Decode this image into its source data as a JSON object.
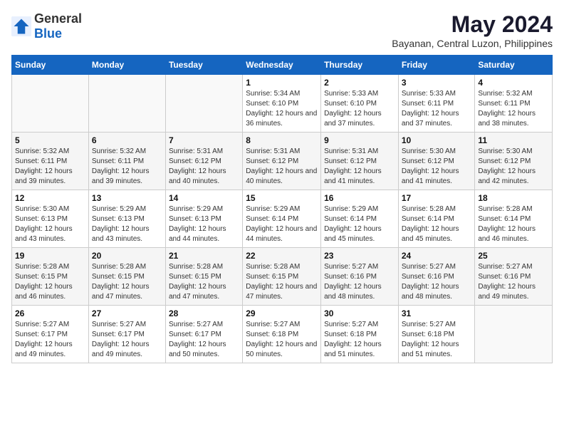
{
  "logo": {
    "general": "General",
    "blue": "Blue"
  },
  "title": "May 2024",
  "subtitle": "Bayanan, Central Luzon, Philippines",
  "weekdays": [
    "Sunday",
    "Monday",
    "Tuesday",
    "Wednesday",
    "Thursday",
    "Friday",
    "Saturday"
  ],
  "weeks": [
    [
      {
        "day": "",
        "info": ""
      },
      {
        "day": "",
        "info": ""
      },
      {
        "day": "",
        "info": ""
      },
      {
        "day": "1",
        "info": "Sunrise: 5:34 AM\nSunset: 6:10 PM\nDaylight: 12 hours and 36 minutes."
      },
      {
        "day": "2",
        "info": "Sunrise: 5:33 AM\nSunset: 6:10 PM\nDaylight: 12 hours and 37 minutes."
      },
      {
        "day": "3",
        "info": "Sunrise: 5:33 AM\nSunset: 6:11 PM\nDaylight: 12 hours and 37 minutes."
      },
      {
        "day": "4",
        "info": "Sunrise: 5:32 AM\nSunset: 6:11 PM\nDaylight: 12 hours and 38 minutes."
      }
    ],
    [
      {
        "day": "5",
        "info": "Sunrise: 5:32 AM\nSunset: 6:11 PM\nDaylight: 12 hours and 39 minutes."
      },
      {
        "day": "6",
        "info": "Sunrise: 5:32 AM\nSunset: 6:11 PM\nDaylight: 12 hours and 39 minutes."
      },
      {
        "day": "7",
        "info": "Sunrise: 5:31 AM\nSunset: 6:12 PM\nDaylight: 12 hours and 40 minutes."
      },
      {
        "day": "8",
        "info": "Sunrise: 5:31 AM\nSunset: 6:12 PM\nDaylight: 12 hours and 40 minutes."
      },
      {
        "day": "9",
        "info": "Sunrise: 5:31 AM\nSunset: 6:12 PM\nDaylight: 12 hours and 41 minutes."
      },
      {
        "day": "10",
        "info": "Sunrise: 5:30 AM\nSunset: 6:12 PM\nDaylight: 12 hours and 41 minutes."
      },
      {
        "day": "11",
        "info": "Sunrise: 5:30 AM\nSunset: 6:12 PM\nDaylight: 12 hours and 42 minutes."
      }
    ],
    [
      {
        "day": "12",
        "info": "Sunrise: 5:30 AM\nSunset: 6:13 PM\nDaylight: 12 hours and 43 minutes."
      },
      {
        "day": "13",
        "info": "Sunrise: 5:29 AM\nSunset: 6:13 PM\nDaylight: 12 hours and 43 minutes."
      },
      {
        "day": "14",
        "info": "Sunrise: 5:29 AM\nSunset: 6:13 PM\nDaylight: 12 hours and 44 minutes."
      },
      {
        "day": "15",
        "info": "Sunrise: 5:29 AM\nSunset: 6:14 PM\nDaylight: 12 hours and 44 minutes."
      },
      {
        "day": "16",
        "info": "Sunrise: 5:29 AM\nSunset: 6:14 PM\nDaylight: 12 hours and 45 minutes."
      },
      {
        "day": "17",
        "info": "Sunrise: 5:28 AM\nSunset: 6:14 PM\nDaylight: 12 hours and 45 minutes."
      },
      {
        "day": "18",
        "info": "Sunrise: 5:28 AM\nSunset: 6:14 PM\nDaylight: 12 hours and 46 minutes."
      }
    ],
    [
      {
        "day": "19",
        "info": "Sunrise: 5:28 AM\nSunset: 6:15 PM\nDaylight: 12 hours and 46 minutes."
      },
      {
        "day": "20",
        "info": "Sunrise: 5:28 AM\nSunset: 6:15 PM\nDaylight: 12 hours and 47 minutes."
      },
      {
        "day": "21",
        "info": "Sunrise: 5:28 AM\nSunset: 6:15 PM\nDaylight: 12 hours and 47 minutes."
      },
      {
        "day": "22",
        "info": "Sunrise: 5:28 AM\nSunset: 6:15 PM\nDaylight: 12 hours and 47 minutes."
      },
      {
        "day": "23",
        "info": "Sunrise: 5:27 AM\nSunset: 6:16 PM\nDaylight: 12 hours and 48 minutes."
      },
      {
        "day": "24",
        "info": "Sunrise: 5:27 AM\nSunset: 6:16 PM\nDaylight: 12 hours and 48 minutes."
      },
      {
        "day": "25",
        "info": "Sunrise: 5:27 AM\nSunset: 6:16 PM\nDaylight: 12 hours and 49 minutes."
      }
    ],
    [
      {
        "day": "26",
        "info": "Sunrise: 5:27 AM\nSunset: 6:17 PM\nDaylight: 12 hours and 49 minutes."
      },
      {
        "day": "27",
        "info": "Sunrise: 5:27 AM\nSunset: 6:17 PM\nDaylight: 12 hours and 49 minutes."
      },
      {
        "day": "28",
        "info": "Sunrise: 5:27 AM\nSunset: 6:17 PM\nDaylight: 12 hours and 50 minutes."
      },
      {
        "day": "29",
        "info": "Sunrise: 5:27 AM\nSunset: 6:18 PM\nDaylight: 12 hours and 50 minutes."
      },
      {
        "day": "30",
        "info": "Sunrise: 5:27 AM\nSunset: 6:18 PM\nDaylight: 12 hours and 51 minutes."
      },
      {
        "day": "31",
        "info": "Sunrise: 5:27 AM\nSunset: 6:18 PM\nDaylight: 12 hours and 51 minutes."
      },
      {
        "day": "",
        "info": ""
      }
    ]
  ]
}
